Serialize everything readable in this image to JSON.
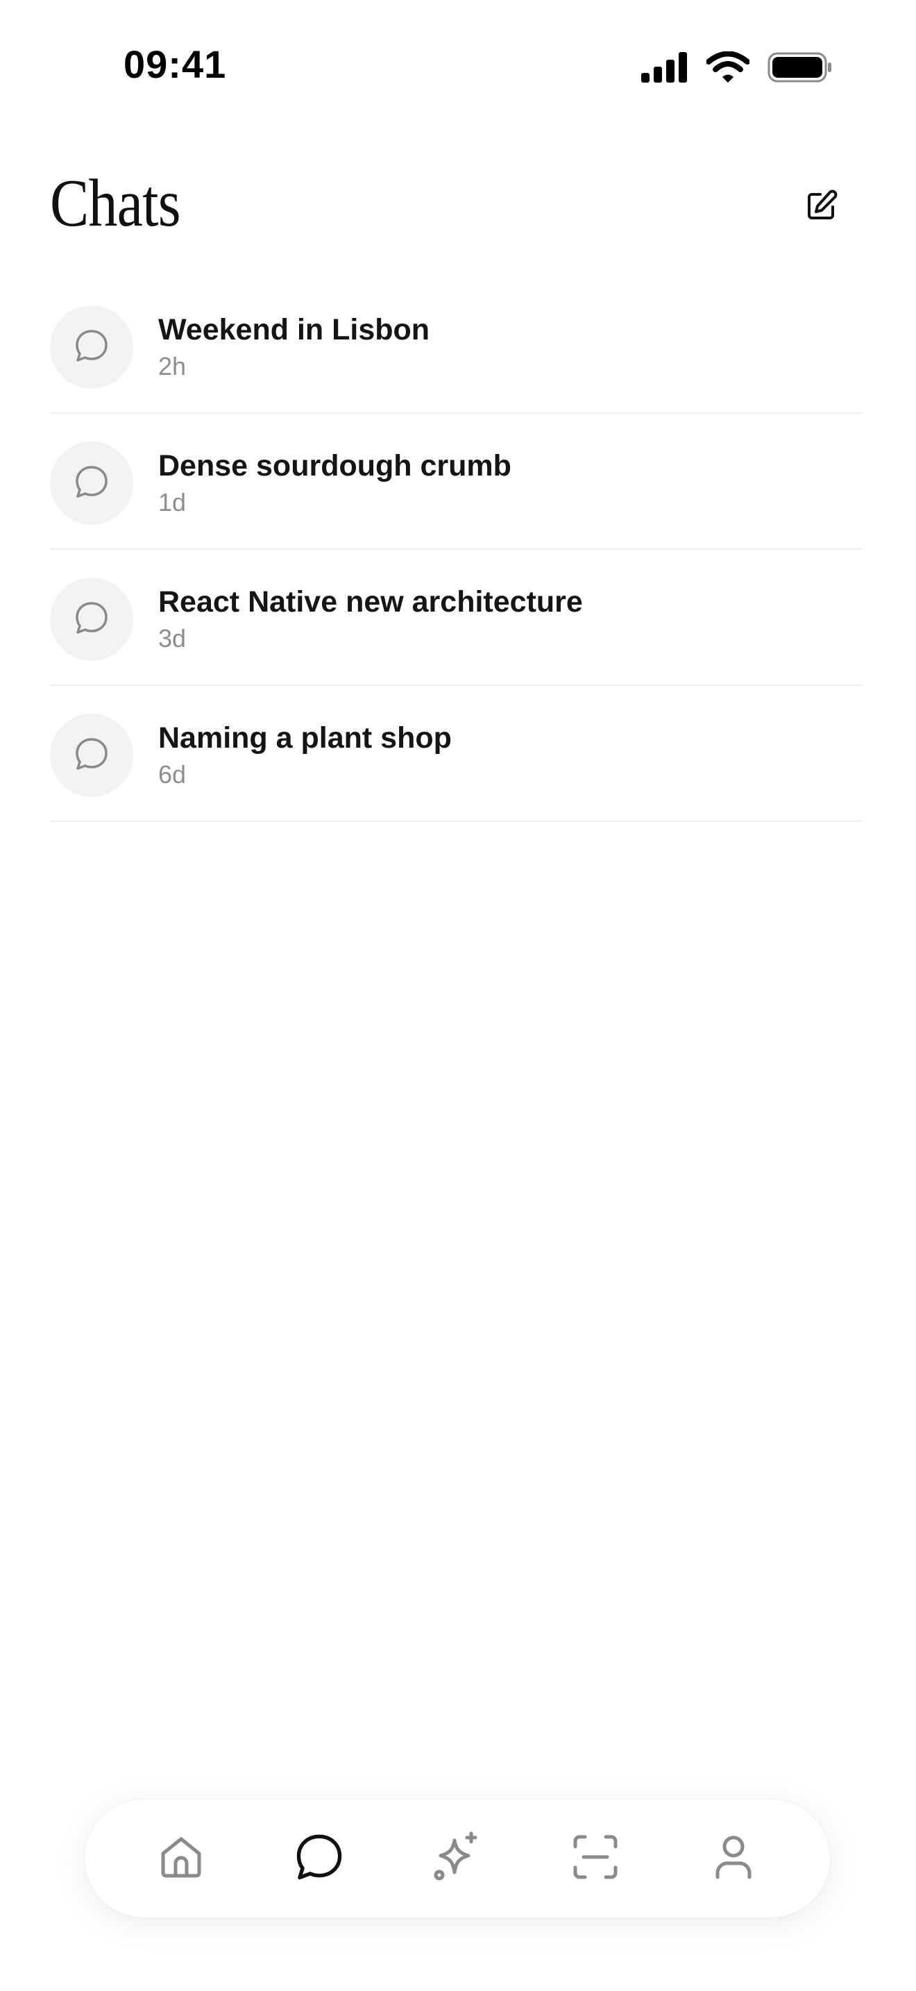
{
  "status_bar": {
    "time": "09:41"
  },
  "header": {
    "title": "Chats",
    "compose_icon": "compose-icon"
  },
  "chats": [
    {
      "title": "Weekend in Lisbon",
      "time": "2h"
    },
    {
      "title": "Dense sourdough crumb",
      "time": "1d"
    },
    {
      "title": "React Native new architecture",
      "time": "3d"
    },
    {
      "title": "Naming a plant shop",
      "time": "6d"
    }
  ],
  "tab_bar": {
    "items": [
      {
        "icon": "home-icon",
        "active": false
      },
      {
        "icon": "chat-bubble-icon",
        "active": true
      },
      {
        "icon": "sparkle-icon",
        "active": false
      },
      {
        "icon": "scan-icon",
        "active": false
      },
      {
        "icon": "profile-icon",
        "active": false
      }
    ]
  },
  "colors": {
    "background": "#ffffff",
    "text_primary": "#151515",
    "text_secondary": "#8d8d8d",
    "avatar_bg": "#f3f3f1",
    "divider": "#ececec",
    "tab_inactive": "#8a8a8a",
    "tab_active": "#111111"
  }
}
